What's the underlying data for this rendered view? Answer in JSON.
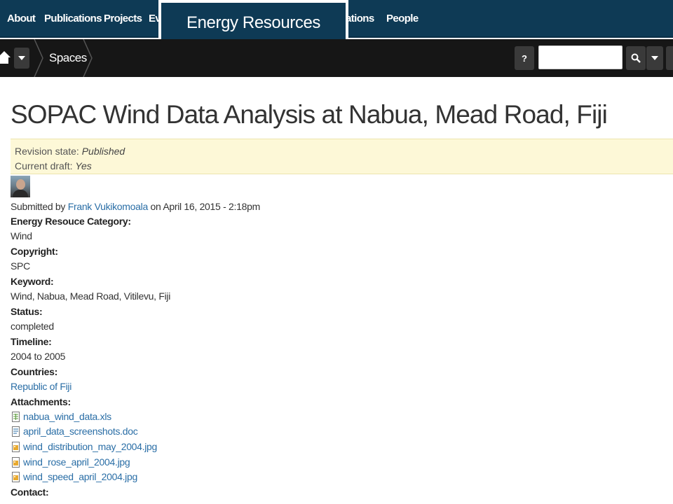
{
  "nav": {
    "items": [
      "About",
      "Publications",
      "Projects",
      "Ev",
      "ations",
      "People"
    ],
    "popup_title": "Energy Resources"
  },
  "toolbar": {
    "breadcrumb": "Spaces",
    "help_label": "?",
    "search_placeholder": ""
  },
  "node": {
    "title": "SOPAC Wind Data Analysis at Nabua, Mead Road, Fiji",
    "revision_state_label": "Revision state:",
    "revision_state_value": "Published",
    "current_draft_label": "Current draft:",
    "current_draft_value": "Yes",
    "submitted_prefix": "Submitted by",
    "author": "Frank Vukikomoala",
    "submitted_on": "on April 16, 2015 - 2:18pm",
    "fields": [
      {
        "label": "Energy Resouce Category:",
        "value": "Wind"
      },
      {
        "label": "Copyright:",
        "value": "SPC"
      },
      {
        "label": "Keyword:",
        "value": "Wind, Nabua, Mead Road, Vitilevu, Fiji"
      },
      {
        "label": "Status:",
        "value": "completed"
      },
      {
        "label": "Timeline:",
        "value": "2004 to 2005"
      }
    ],
    "countries_label": "Countries:",
    "countries_value": "Republic of Fiji",
    "attachments_label": "Attachments:",
    "attachments": [
      {
        "name": "nabua_wind_data.xls",
        "icon": "spreadsheet-file-icon"
      },
      {
        "name": "april_data_screenshots.doc",
        "icon": "document-file-icon"
      },
      {
        "name": "wind_distribution_may_2004.jpg",
        "icon": "image-file-icon"
      },
      {
        "name": "wind_rose_april_2004.jpg",
        "icon": "image-file-icon"
      },
      {
        "name": "wind_speed_april_2004.jpg",
        "icon": "image-file-icon"
      }
    ],
    "contact_label": "Contact:"
  },
  "colors": {
    "nav_bg": "#0e3a55",
    "toolbar_bg": "#161616",
    "link": "#2a6ea6",
    "revision_bg": "#fdf8d7"
  }
}
